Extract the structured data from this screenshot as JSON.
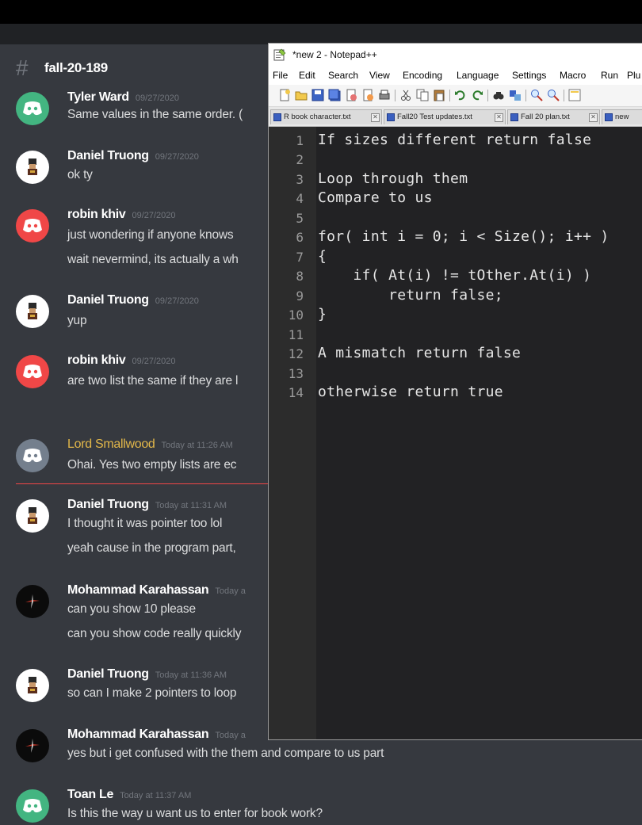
{
  "channel": {
    "name": "fall-20-189"
  },
  "messages": [
    {
      "user": "Tyler Ward",
      "time": "09/27/2020",
      "lines": [
        "Same values in the same order. ("
      ]
    },
    {
      "user": "Daniel Truong",
      "time": "09/27/2020",
      "lines": [
        "ok ty"
      ]
    },
    {
      "user": "robin khiv",
      "time": "09/27/2020",
      "lines": [
        "just wondering if anyone knows",
        "wait nevermind, its actually a wh"
      ]
    },
    {
      "user": "Daniel Truong",
      "time": "09/27/2020",
      "lines": [
        "yup"
      ]
    },
    {
      "user": "robin khiv",
      "time": "09/27/2020",
      "lines": [
        "are two list the same if they are l"
      ]
    },
    {
      "user": "Lord Smallwood",
      "time": "Today at 11:26 AM",
      "lines": [
        "Ohai.  Yes two empty lists are ec"
      ]
    },
    {
      "user": "Daniel Truong",
      "time": "Today at 11:31 AM",
      "lines": [
        "I thought it was pointer too lol",
        "yeah cause in the program part,"
      ]
    },
    {
      "user": "Mohammad Karahassan",
      "time": "Today a",
      "lines": [
        "can you show 10 please",
        "can you show code really quickly"
      ]
    },
    {
      "user": "Daniel Truong",
      "time": "Today at 11:36 AM",
      "lines": [
        "so can I make 2 pointers to loop"
      ]
    },
    {
      "user": "Mohammad Karahassan",
      "time": "Today a",
      "lines": [
        "yes but i get confused with the them and compare to us part"
      ]
    },
    {
      "user": "Toan Le",
      "time": "Today at 11:37 AM",
      "lines": [
        "Is this the way u want us to enter for book work?"
      ]
    }
  ],
  "notepad": {
    "title": "*new 2 - Notepad++",
    "menu": [
      "File",
      "Edit",
      "Search",
      "View",
      "Encoding",
      "Language",
      "Settings",
      "Macro",
      "Run",
      "Plu"
    ],
    "tabs": [
      "R book character.txt",
      "Fall20 Test updates.txt",
      "Fall 20 plan.txt",
      "new"
    ],
    "code_lines": [
      "If sizes different return false",
      "",
      "Loop through them",
      "Compare to us",
      "",
      "for( int i = 0; i < Size(); i++ )",
      "{",
      "    if( At(i) != tOther.At(i) )",
      "        return false;",
      "}",
      "",
      "A mismatch return false",
      "",
      "otherwise return true"
    ],
    "line_numbers": [
      "1",
      "2",
      "3",
      "4",
      "5",
      "6",
      "7",
      "8",
      "9",
      "10",
      "11",
      "12",
      "13",
      "14"
    ]
  },
  "colors": {
    "discord_bg": "#36393f",
    "lord_name": "#e2b74a",
    "new_divider": "#f04747",
    "editor_bg": "#222224"
  }
}
